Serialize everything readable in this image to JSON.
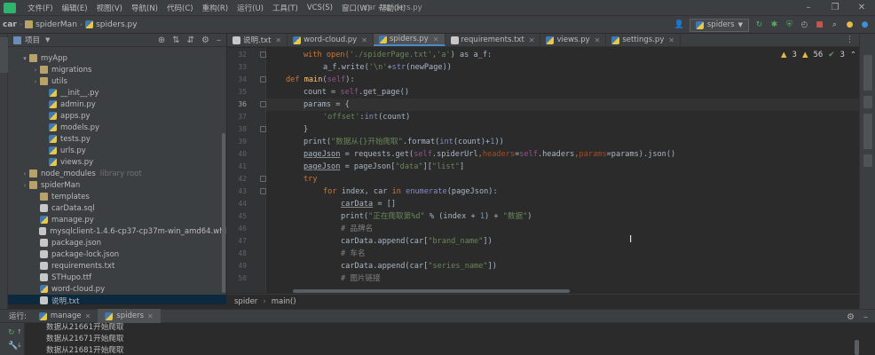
{
  "menubar": {
    "items": [
      "文件(F)",
      "编辑(E)",
      "视图(V)",
      "导航(N)",
      "代码(C)",
      "重构(R)",
      "运行(U)",
      "工具(T)",
      "VCS(S)",
      "窗口(W)",
      "帮助(H)"
    ],
    "window_title": "car - spiders.py"
  },
  "navbar": {
    "crumbs": [
      "car",
      "spiderMan",
      "spiders.py"
    ],
    "run_config": "spiders"
  },
  "project_panel": {
    "title": "项目",
    "tree": [
      {
        "label": "myApp",
        "arrow": "▾",
        "icon": "folder"
      },
      {
        "label": "migrations",
        "arrow": "›",
        "icon": "folder"
      },
      {
        "label": "utils",
        "arrow": "›",
        "icon": "folder"
      },
      {
        "label": "__init__.py",
        "arrow": "",
        "icon": "py"
      },
      {
        "label": "admin.py",
        "arrow": "",
        "icon": "py"
      },
      {
        "label": "apps.py",
        "arrow": "",
        "icon": "py"
      },
      {
        "label": "models.py",
        "arrow": "",
        "icon": "py"
      },
      {
        "label": "tests.py",
        "arrow": "",
        "icon": "py"
      },
      {
        "label": "urls.py",
        "arrow": "",
        "icon": "py"
      },
      {
        "label": "views.py",
        "arrow": "",
        "icon": "py"
      },
      {
        "label": "node_modules",
        "arrow": "›",
        "icon": "folder",
        "hint": "library root"
      },
      {
        "label": "spiderMan",
        "arrow": "›",
        "icon": "folder"
      },
      {
        "label": "templates",
        "arrow": "",
        "icon": "folder"
      },
      {
        "label": "carData.sql",
        "arrow": "",
        "icon": "txt"
      },
      {
        "label": "manage.py",
        "arrow": "",
        "icon": "py"
      },
      {
        "label": "mysqlclient-1.4.6-cp37-cp37m-win_amd64.whl",
        "arrow": "",
        "icon": "txt"
      },
      {
        "label": "package.json",
        "arrow": "",
        "icon": "txt"
      },
      {
        "label": "package-lock.json",
        "arrow": "",
        "icon": "txt"
      },
      {
        "label": "requirements.txt",
        "arrow": "",
        "icon": "txt"
      },
      {
        "label": "STHupo.ttf",
        "arrow": "",
        "icon": "txt"
      },
      {
        "label": "word-cloud.py",
        "arrow": "",
        "icon": "py"
      },
      {
        "label": "说明.txt",
        "arrow": "",
        "icon": "txt",
        "selected": true
      }
    ]
  },
  "tabs": [
    {
      "label": "说明.txt",
      "icon": "txt"
    },
    {
      "label": "word-cloud.py",
      "icon": "py"
    },
    {
      "label": "spiders.py",
      "icon": "py",
      "active": true
    },
    {
      "label": "requirements.txt",
      "icon": "txt"
    },
    {
      "label": "views.py",
      "icon": "py"
    },
    {
      "label": "settings.py",
      "icon": "py"
    }
  ],
  "inspections": {
    "warnings": "3",
    "weak_warnings": "56",
    "typos": "3"
  },
  "line_numbers": [
    "32",
    "33",
    "34",
    "35",
    "36",
    "37",
    "38",
    "39",
    "40",
    "41",
    "42",
    "43",
    "44",
    "45",
    "46",
    "47",
    "48",
    "49",
    "50"
  ],
  "current_line": "36",
  "code": {
    "l32a": "with open(",
    "l32b": "'./spiderPage.txt'",
    "l32c": ",",
    "l32d": "'a'",
    "l32e": ") as a_f:",
    "l33a": "a_f.write(",
    "l33b": "'\\n'",
    "l33c": "+",
    "l33d": "str",
    "l33e": "(newPage))",
    "l34a": "def ",
    "l34b": "main",
    "l34c": "(",
    "l34d": "self",
    "l34e": "):",
    "l35a": "count = ",
    "l35b": "self",
    "l35c": ".get_page()",
    "l36a": "params = {",
    "l37a": "'offset'",
    "l37b": ":",
    "l37c": "int",
    "l37d": "(count)",
    "l38a": "}",
    "l39a": "print(",
    "l39b": "\"数据从{}开始爬取\"",
    "l39c": ".format(",
    "l39d": "int",
    "l39e": "(count)+",
    "l39f": "1",
    "l39g": "))",
    "l40a": "pageJson",
    "l40b": " = requests.get(",
    "l40c": "self",
    "l40d": ".spiderUrl",
    "l40e": ",",
    "l40f": "headers",
    "l40g": "=",
    "l40h": "self",
    "l40i": ".headers",
    "l40j": ",",
    "l40k": "params",
    "l40l": "=params).json()",
    "l41a": "pageJson",
    "l41b": " = pageJson[",
    "l41c": "\"data\"",
    "l41d": "][",
    "l41e": "\"list\"",
    "l41f": "]",
    "l42a": "try",
    "l43a": "for ",
    "l43b": "index, car ",
    "l43c": "in ",
    "l43d": "enumerate",
    "l43e": "(pageJson):",
    "l44a": "carData",
    "l44b": " = []",
    "l45a": "print(",
    "l45b": "\"正在爬取第%d\"",
    "l45c": " % (index + ",
    "l45d": "1",
    "l45e": ") + ",
    "l45f": "\"数据\"",
    "l45g": ")",
    "l46a": "# 品牌名",
    "l47a": "carData.append(car[",
    "l47b": "\"brand_name\"",
    "l47c": "])",
    "l48a": "# 车名",
    "l49a": "carData.append(car[",
    "l49b": "\"series_name\"",
    "l49c": "])",
    "l50a": "# 图片链接"
  },
  "editor_breadcrumb": [
    "spider",
    "main()"
  ],
  "run_panel": {
    "label": "运行:",
    "tabs": [
      {
        "label": "manage"
      },
      {
        "label": "spiders",
        "active": true
      }
    ],
    "console_lines": [
      "数据从21661开始爬取",
      "数据从21671开始爬取",
      "数据从21681开始爬取"
    ]
  },
  "colors": {
    "accent": "#4a88c7",
    "keyword": "#cc7832",
    "string": "#6a8759",
    "function": "#ffc66d",
    "self": "#94558d"
  }
}
